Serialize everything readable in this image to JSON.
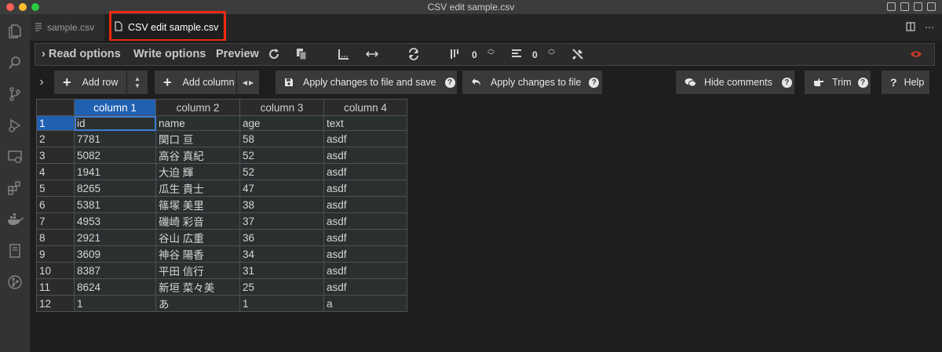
{
  "window": {
    "title": "CSV edit sample.csv"
  },
  "tabs": [
    {
      "label": "sample.csv"
    },
    {
      "label": "CSV edit sample.csv"
    }
  ],
  "activity_bar": [
    "files-icon",
    "search-icon",
    "source-control-icon",
    "run-debug-icon",
    "remote-explorer-icon",
    "extensions-icon",
    "docker-icon",
    "notebook-icon",
    "git-graph-icon"
  ],
  "toolbar": {
    "read_options": "Read options",
    "write_options": "Write options",
    "preview": "Preview",
    "fixed_rows": "0",
    "fixed_cols": "0"
  },
  "buttons": {
    "add_row": "Add row",
    "add_column": "Add column",
    "apply_save": "Apply changes to file and save",
    "apply": "Apply changes to file",
    "hide_comments": "Hide comments",
    "trim": "Trim",
    "help": "Help",
    "help_q": "?"
  },
  "grid": {
    "columns": [
      "column 1",
      "column 2",
      "column 3",
      "column 4"
    ],
    "rows": [
      [
        "1",
        "id",
        "name",
        "age",
        "text"
      ],
      [
        "2",
        "7781",
        "関口 亘",
        "58",
        "asdf"
      ],
      [
        "3",
        "5082",
        "高谷 真紀",
        "52",
        "asdf"
      ],
      [
        "4",
        "1941",
        "大迫 輝",
        "52",
        "asdf"
      ],
      [
        "5",
        "8265",
        "瓜生 貴士",
        "47",
        "asdf"
      ],
      [
        "6",
        "5381",
        "篠塚 美里",
        "38",
        "asdf"
      ],
      [
        "7",
        "4953",
        "磯崎 彩音",
        "37",
        "asdf"
      ],
      [
        "8",
        "2921",
        "谷山 広重",
        "36",
        "asdf"
      ],
      [
        "9",
        "3609",
        "神谷 陽香",
        "34",
        "asdf"
      ],
      [
        "10",
        "8387",
        "平田 信行",
        "31",
        "asdf"
      ],
      [
        "11",
        "8624",
        "新垣 菜々美",
        "25",
        "asdf"
      ],
      [
        "12",
        "1",
        "あ",
        "1",
        "a"
      ]
    ]
  },
  "colors": {
    "accent": "#2060b0",
    "tab_highlight": "#ee2a10",
    "preview_eye": "#c0392b"
  }
}
